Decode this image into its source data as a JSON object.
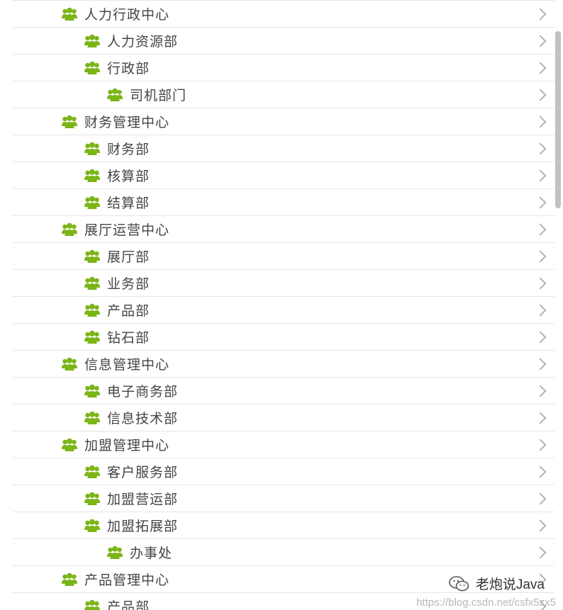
{
  "tree": {
    "items": [
      {
        "label": "人力行政中心",
        "level": 0
      },
      {
        "label": "人力资源部",
        "level": 1
      },
      {
        "label": "行政部",
        "level": 1
      },
      {
        "label": "司机部门",
        "level": 2
      },
      {
        "label": "财务管理中心",
        "level": 0
      },
      {
        "label": "财务部",
        "level": 1
      },
      {
        "label": "核算部",
        "level": 1
      },
      {
        "label": "结算部",
        "level": 1
      },
      {
        "label": "展厅运营中心",
        "level": 0
      },
      {
        "label": "展厅部",
        "level": 1
      },
      {
        "label": "业务部",
        "level": 1
      },
      {
        "label": "产品部",
        "level": 1
      },
      {
        "label": "钻石部",
        "level": 1
      },
      {
        "label": "信息管理中心",
        "level": 0
      },
      {
        "label": "电子商务部",
        "level": 1
      },
      {
        "label": "信息技术部",
        "level": 1
      },
      {
        "label": "加盟管理中心",
        "level": 0
      },
      {
        "label": "客户服务部",
        "level": 1
      },
      {
        "label": "加盟营运部",
        "level": 1
      },
      {
        "label": "加盟拓展部",
        "level": 1
      },
      {
        "label": "办事处",
        "level": 2
      },
      {
        "label": "产品管理中心",
        "level": 0
      },
      {
        "label": "产品部",
        "level": 1
      }
    ],
    "icon": "group-users-icon",
    "icon_color": "#7cb518",
    "chevron_icon": "chevron-right-icon"
  },
  "overlay": {
    "brand_text": "老炮说Java",
    "brand_icon": "wechat-icon",
    "watermark": "https://blog.csdn.net/csfx5zx5"
  }
}
